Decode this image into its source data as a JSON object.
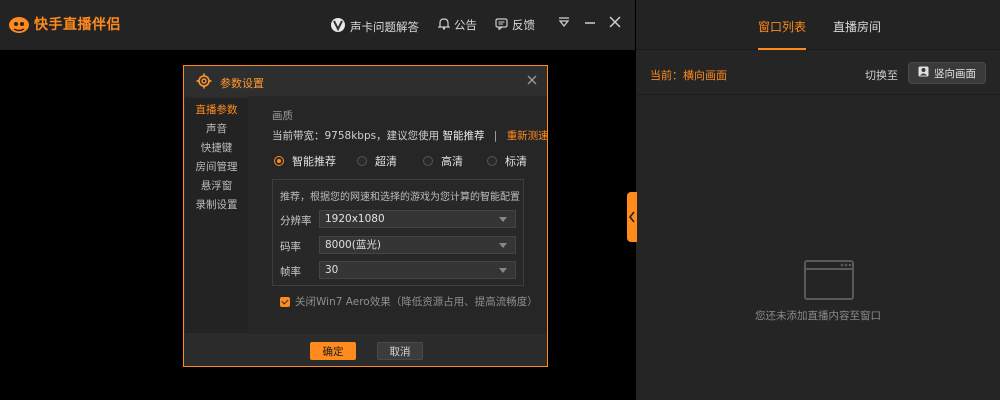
{
  "app": {
    "title": "快手直播伴侣",
    "brand_color": "#ff8a1e"
  },
  "toolbar": {
    "help_label": "声卡问题解答",
    "notice_label": "公告",
    "feedback_label": "反馈"
  },
  "right_panel": {
    "tabs": [
      {
        "label": "窗口列表",
        "active": true
      },
      {
        "label": "直播房间",
        "active": false
      }
    ],
    "current_mode": "当前：横向画面",
    "switch_label": "切换至",
    "vertical_button": "竖向画面",
    "empty_text": "您还未添加直播内容至窗口"
  },
  "dialog": {
    "title": "参数设置",
    "nav": [
      {
        "label": "直播参数",
        "active": true
      },
      {
        "label": "声音",
        "active": false
      },
      {
        "label": "快捷键",
        "active": false
      },
      {
        "label": "房间管理",
        "active": false
      },
      {
        "label": "悬浮窗",
        "active": false
      },
      {
        "label": "录制设置",
        "active": false
      }
    ],
    "section_label": "画质",
    "bandwidth_text": "当前带宽：9758kbps，建议您使用",
    "recommend": "智能推荐",
    "separator": "|",
    "retest": "重新测速",
    "quality_options": [
      {
        "label": "智能推荐",
        "checked": true
      },
      {
        "label": "超清",
        "checked": false
      },
      {
        "label": "高清",
        "checked": false
      },
      {
        "label": "标清",
        "checked": false
      }
    ],
    "hint": "推荐，根据您的网速和选择的游戏为您计算的智能配置",
    "fields": [
      {
        "label": "分辨率",
        "value": "1920x1080"
      },
      {
        "label": "码率",
        "value": "8000(蓝光)"
      },
      {
        "label": "帧率",
        "value": "30"
      }
    ],
    "aero_checkbox": {
      "label": "关闭Win7 Aero效果（降低资源占用、提高流畅度）",
      "checked": true
    },
    "ok_label": "确定",
    "cancel_label": "取消"
  }
}
